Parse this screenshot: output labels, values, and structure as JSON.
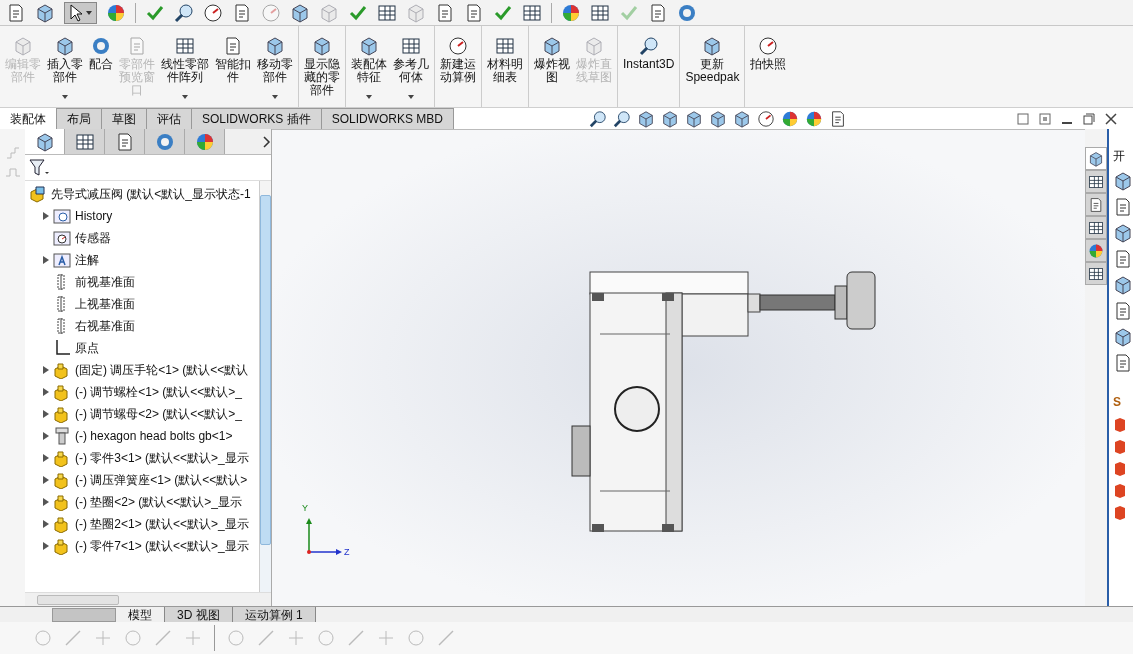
{
  "command_groups": [
    [
      {
        "lines": [
          "编辑零",
          "部件"
        ],
        "disabled": true,
        "dropdown": false
      },
      {
        "lines": [
          "插入零",
          "部件"
        ],
        "disabled": false,
        "dropdown": true
      },
      {
        "lines": [
          "配合"
        ],
        "disabled": false,
        "dropdown": false
      },
      {
        "lines": [
          "零部件",
          "预览窗",
          "口"
        ],
        "disabled": true,
        "dropdown": false
      },
      {
        "lines": [
          "线性零部",
          "件阵列"
        ],
        "disabled": false,
        "dropdown": true
      },
      {
        "lines": [
          "智能扣",
          "件"
        ],
        "disabled": false,
        "dropdown": false
      },
      {
        "lines": [
          "移动零",
          "部件"
        ],
        "disabled": false,
        "dropdown": true
      }
    ],
    [
      {
        "lines": [
          "显示隐",
          "藏的零",
          "部件"
        ],
        "disabled": false,
        "dropdown": false
      }
    ],
    [
      {
        "lines": [
          "装配体",
          "特征"
        ],
        "disabled": false,
        "dropdown": true
      },
      {
        "lines": [
          "参考几",
          "何体"
        ],
        "disabled": false,
        "dropdown": true
      }
    ],
    [
      {
        "lines": [
          "新建运",
          "动算例"
        ],
        "disabled": false,
        "dropdown": false
      }
    ],
    [
      {
        "lines": [
          "材料明",
          "细表"
        ],
        "disabled": false,
        "dropdown": false
      }
    ],
    [
      {
        "lines": [
          "爆炸视",
          "图"
        ],
        "disabled": false,
        "dropdown": false
      },
      {
        "lines": [
          "爆炸直",
          "线草图"
        ],
        "disabled": true,
        "dropdown": false
      }
    ],
    [
      {
        "lines": [
          "Instant3D"
        ],
        "disabled": false,
        "dropdown": false
      }
    ],
    [
      {
        "lines": [
          "更新",
          "Speedpak"
        ],
        "disabled": false,
        "dropdown": false
      }
    ],
    [
      {
        "lines": [
          "拍快照"
        ],
        "disabled": false,
        "dropdown": false
      }
    ]
  ],
  "tabs": [
    {
      "label": "装配体",
      "selected": true
    },
    {
      "label": "布局",
      "selected": false
    },
    {
      "label": "草图",
      "selected": false
    },
    {
      "label": "评估",
      "selected": false
    },
    {
      "label": "SOLIDWORKS 插件",
      "selected": false
    },
    {
      "label": "SOLIDWORKS MBD",
      "selected": false
    }
  ],
  "tree_tabs": [
    {
      "selected": true
    },
    {
      "selected": false
    },
    {
      "selected": false
    },
    {
      "selected": false
    },
    {
      "selected": false
    }
  ],
  "feature_tree": {
    "root": "先导式减压阀  (默认<默认_显示状态-1",
    "items": [
      {
        "kind": "history",
        "label": "History",
        "expandable": true
      },
      {
        "kind": "sensor",
        "label": "传感器",
        "expandable": false
      },
      {
        "kind": "annotation",
        "label": "注解",
        "expandable": true
      },
      {
        "kind": "plane",
        "label": "前视基准面",
        "expandable": false
      },
      {
        "kind": "plane",
        "label": "上视基准面",
        "expandable": false
      },
      {
        "kind": "plane",
        "label": "右视基准面",
        "expandable": false
      },
      {
        "kind": "origin",
        "label": "原点",
        "expandable": false
      },
      {
        "kind": "part",
        "label": "(固定) 调压手轮<1> (默认<<默认",
        "expandable": true
      },
      {
        "kind": "part",
        "label": "(-) 调节螺栓<1> (默认<<默认>_",
        "expandable": true
      },
      {
        "kind": "part",
        "label": "(-) 调节螺母<2> (默认<<默认>_",
        "expandable": true
      },
      {
        "kind": "bolt",
        "label": "(-) hexagon head bolts gb<1>",
        "expandable": true
      },
      {
        "kind": "part",
        "label": "(-) 零件3<1> (默认<<默认>_显示",
        "expandable": true
      },
      {
        "kind": "part",
        "label": "(-) 调压弹簧座<1> (默认<<默认>",
        "expandable": true
      },
      {
        "kind": "part",
        "label": "(-) 垫圈<2> (默认<<默认>_显示",
        "expandable": true
      },
      {
        "kind": "part",
        "label": "(-) 垫圈2<1> (默认<<默认>_显示",
        "expandable": true
      },
      {
        "kind": "part",
        "label": "(-) 零件7<1> (默认<<默认>_显示",
        "expandable": true
      }
    ]
  },
  "viewport": {
    "triad": {
      "y_label": "Y",
      "z_label": "Z"
    }
  },
  "task_pane_tabs": [
    {
      "selected": true
    },
    {
      "selected": false
    },
    {
      "selected": false
    },
    {
      "selected": false
    },
    {
      "selected": false
    },
    {
      "selected": false
    }
  ],
  "task_pane": {
    "header": "开",
    "section": "S"
  },
  "bottom_tabs": [
    {
      "label": "模型",
      "selected": true
    },
    {
      "label": "3D 视图",
      "selected": false
    },
    {
      "label": "运动算例 1",
      "selected": false
    }
  ]
}
